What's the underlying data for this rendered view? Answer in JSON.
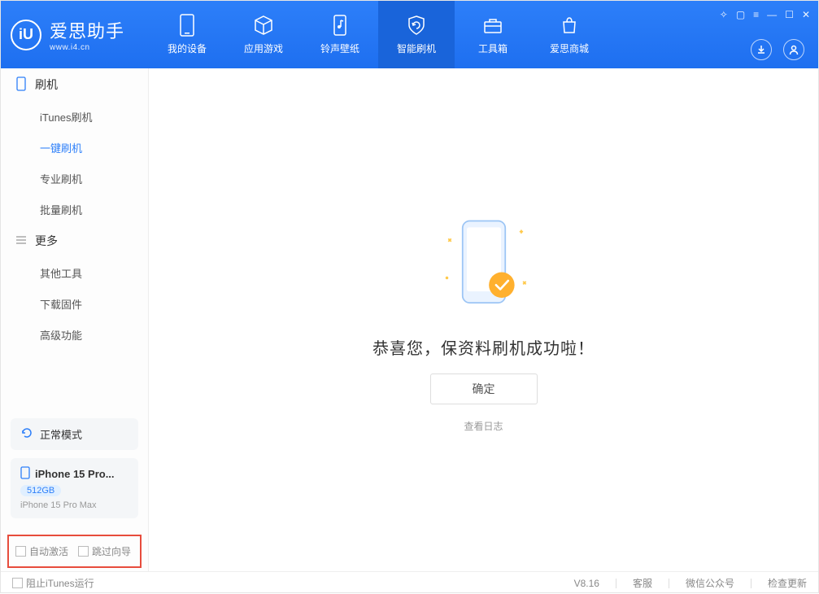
{
  "branding": {
    "logo_glyph": "iU",
    "title": "爱思助手",
    "subtitle": "www.i4.cn"
  },
  "nav": [
    {
      "label": "我的设备"
    },
    {
      "label": "应用游戏"
    },
    {
      "label": "铃声壁纸"
    },
    {
      "label": "智能刷机"
    },
    {
      "label": "工具箱"
    },
    {
      "label": "爱思商城"
    }
  ],
  "sidebar": {
    "sections": [
      {
        "title": "刷机",
        "items": [
          "iTunes刷机",
          "一键刷机",
          "专业刷机",
          "批量刷机"
        ]
      },
      {
        "title": "更多",
        "items": [
          "其他工具",
          "下载固件",
          "高级功能"
        ]
      }
    ],
    "mode": "正常模式",
    "device": {
      "name": "iPhone 15 Pro...",
      "storage": "512GB",
      "subtitle": "iPhone 15 Pro Max"
    },
    "checkboxes": {
      "auto_activate": "自动激活",
      "skip_wizard": "跳过向导"
    }
  },
  "main": {
    "success_message": "恭喜您，保资料刷机成功啦！",
    "ok_button": "确定",
    "view_log": "查看日志"
  },
  "footer": {
    "block_itunes": "阻止iTunes运行",
    "version": "V8.16",
    "links": [
      "客服",
      "微信公众号",
      "检查更新"
    ]
  }
}
